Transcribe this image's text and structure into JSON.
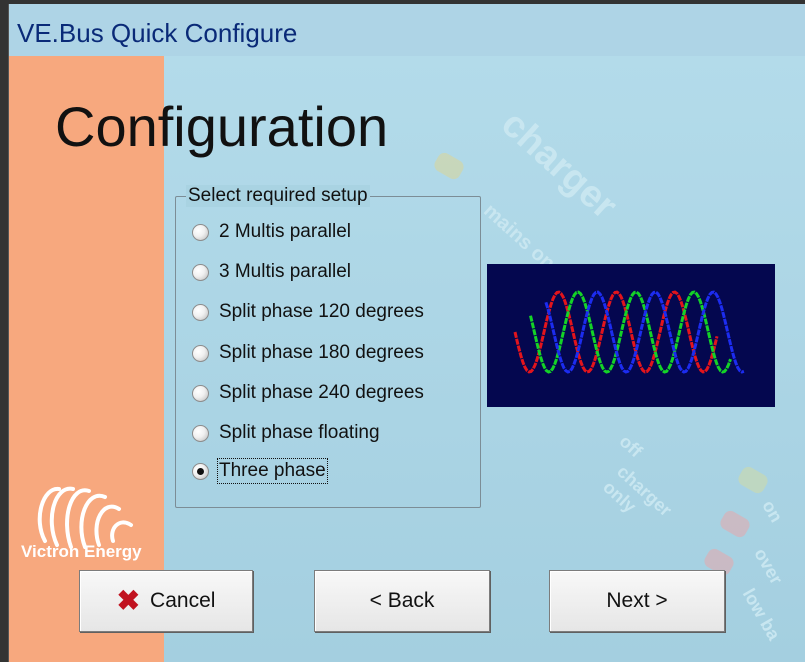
{
  "window": {
    "title": "VE.Bus Quick Configure"
  },
  "page": {
    "heading": "Configuration"
  },
  "background_text": [
    "charger",
    "mains on",
    "off",
    "charger only",
    "on",
    "over",
    "low ba"
  ],
  "setup_group": {
    "legend": "Select required setup",
    "selected_index": 6,
    "options": [
      "2 Multis parallel",
      "3 Multis parallel",
      "Split phase 120 degrees",
      "Split phase 180 degrees",
      "Split phase 240 degrees",
      "Split phase floating",
      "Three phase"
    ]
  },
  "waveform": {
    "colors": [
      "#e3141c",
      "#14d327",
      "#1c2cf0"
    ]
  },
  "brand": {
    "name": "Victron Energy"
  },
  "buttons": {
    "cancel": "Cancel",
    "back": "< Back",
    "next": "Next >"
  },
  "icons": {
    "cancel": "close-icon"
  },
  "colors": {
    "accent_panel": "#f7a87e",
    "background": "#a9d3e2",
    "title_text": "#0a2a78",
    "wave_bg": "#04074f"
  }
}
